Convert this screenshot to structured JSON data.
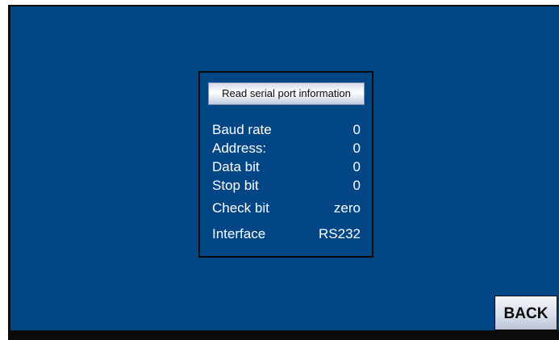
{
  "serial_info": {
    "title": "Read serial port information",
    "rows": [
      {
        "label": "Baud rate",
        "value": "0"
      },
      {
        "label": "Address:",
        "value": "0"
      },
      {
        "label": "Data bit",
        "value": "0"
      },
      {
        "label": "Stop bit",
        "value": "0"
      },
      {
        "label": "Check bit",
        "value": "zero"
      },
      {
        "label": "Interface",
        "value": "RS232"
      }
    ]
  },
  "buttons": {
    "back_label": "BACK"
  },
  "colors": {
    "background": "#034686",
    "text": "#ffffff",
    "border": "#0a0a0a"
  }
}
